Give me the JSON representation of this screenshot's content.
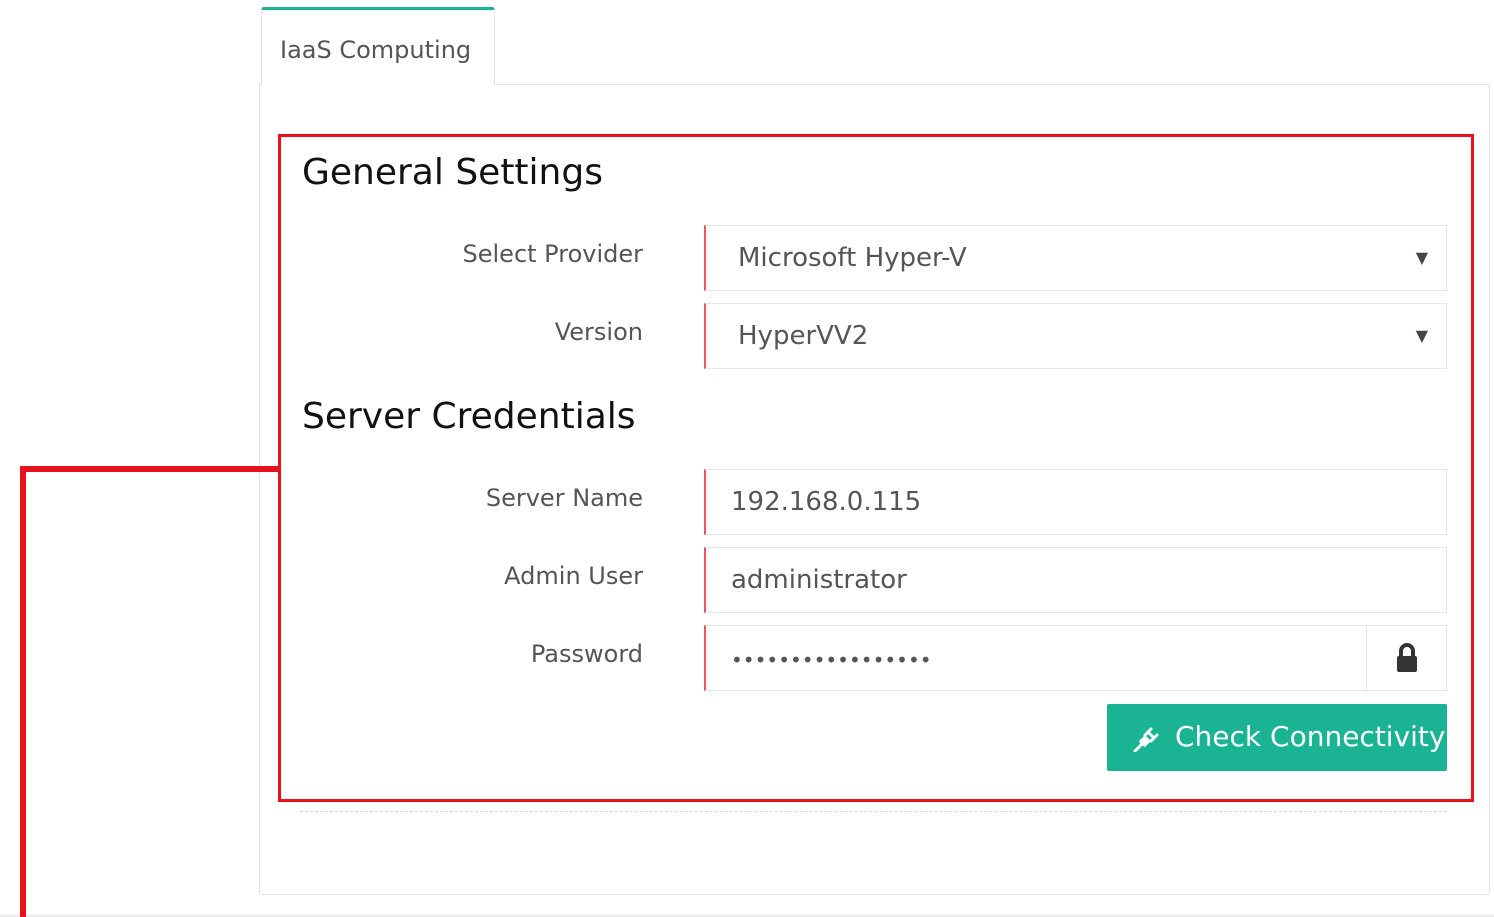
{
  "tab": {
    "label": "IaaS Computing"
  },
  "general_settings": {
    "title": "General Settings",
    "provider": {
      "label": "Select Provider",
      "value": "Microsoft Hyper-V"
    },
    "version": {
      "label": "Version",
      "value": "HyperVV2"
    }
  },
  "server_credentials": {
    "title": "Server Credentials",
    "server_name": {
      "label": "Server Name",
      "value": "192.168.0.115"
    },
    "admin_user": {
      "label": "Admin User",
      "value": "administrator"
    },
    "password": {
      "label": "Password",
      "value": "•••••••••••••••••"
    }
  },
  "actions": {
    "check_connectivity": "Check Connectivity"
  },
  "icons": {
    "dropdown": "chevron-down-icon",
    "password_addon": "lock-icon",
    "check_button": "plug-icon"
  },
  "colors": {
    "accent": "#1ab394",
    "required_border": "#ed5565",
    "highlight": "#e8121a"
  }
}
